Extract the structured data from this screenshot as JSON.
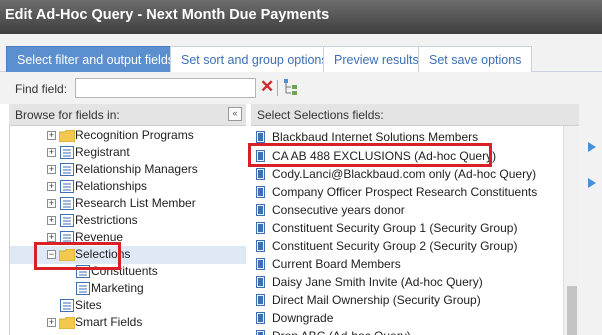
{
  "window": {
    "title": "Edit Ad-Hoc Query - Next Month Due Payments"
  },
  "tabs": [
    {
      "label": "Select filter and output fields",
      "active": true
    },
    {
      "label": "Set sort and group options"
    },
    {
      "label": "Preview results"
    },
    {
      "label": "Set save options"
    }
  ],
  "find": {
    "label": "Find field:",
    "value": "",
    "placeholder": ""
  },
  "left": {
    "header": "Browse for fields in:",
    "collapse_glyph": "«",
    "items": [
      {
        "label": "Recognition Programs",
        "icon": "folder",
        "expander": "+"
      },
      {
        "label": "Registrant",
        "icon": "form",
        "expander": "+"
      },
      {
        "label": "Relationship Managers",
        "icon": "form",
        "expander": "+"
      },
      {
        "label": "Relationships",
        "icon": "form",
        "expander": "+"
      },
      {
        "label": "Research List Member",
        "icon": "form",
        "expander": "+"
      },
      {
        "label": "Restrictions",
        "icon": "form",
        "expander": "+"
      },
      {
        "label": "Revenue",
        "icon": "form",
        "expander": "+"
      },
      {
        "label": "Selections",
        "icon": "folder",
        "expander": "−",
        "selected": true
      },
      {
        "label": "Constituents",
        "icon": "form"
      },
      {
        "label": "Marketing",
        "icon": "form"
      },
      {
        "label": "Sites",
        "icon": "form"
      },
      {
        "label": "Smart Fields",
        "icon": "folder",
        "expander": "+"
      }
    ]
  },
  "right": {
    "header": "Select Selections fields:",
    "items": [
      {
        "label": "Blackbaud Internet Solutions Members"
      },
      {
        "label": "CA AB 488 EXCLUSIONS (Ad-hoc Query)",
        "highlighted": true
      },
      {
        "label": "Cody.Lanci@Blackbaud.com only (Ad-hoc Query)"
      },
      {
        "label": "Company Officer Prospect Research Constituents"
      },
      {
        "label": "Consecutive years donor"
      },
      {
        "label": "Constituent Security Group 1 (Security Group)"
      },
      {
        "label": "Constituent Security Group 2 (Security Group)"
      },
      {
        "label": "Current Board Members"
      },
      {
        "label": "Daisy Jane Smith Invite (Ad-hoc Query)"
      },
      {
        "label": "Direct Mail Ownership (Security Group)"
      },
      {
        "label": "Downgrade"
      },
      {
        "label": "Drop ABC (Ad-hoc Query)"
      }
    ]
  },
  "colors": {
    "title_bar": "#4f4f4f",
    "active_tab": "#5b8fd0",
    "highlight": "#d82127",
    "link_blue": "#3b6fb6",
    "query_icon": "#3f6fb5"
  },
  "icons": {
    "clear": "red-x-icon",
    "tree_toggle": "tree-view-icon",
    "folder": "folder-icon",
    "form": "form-icon",
    "query": "selection-icon"
  }
}
